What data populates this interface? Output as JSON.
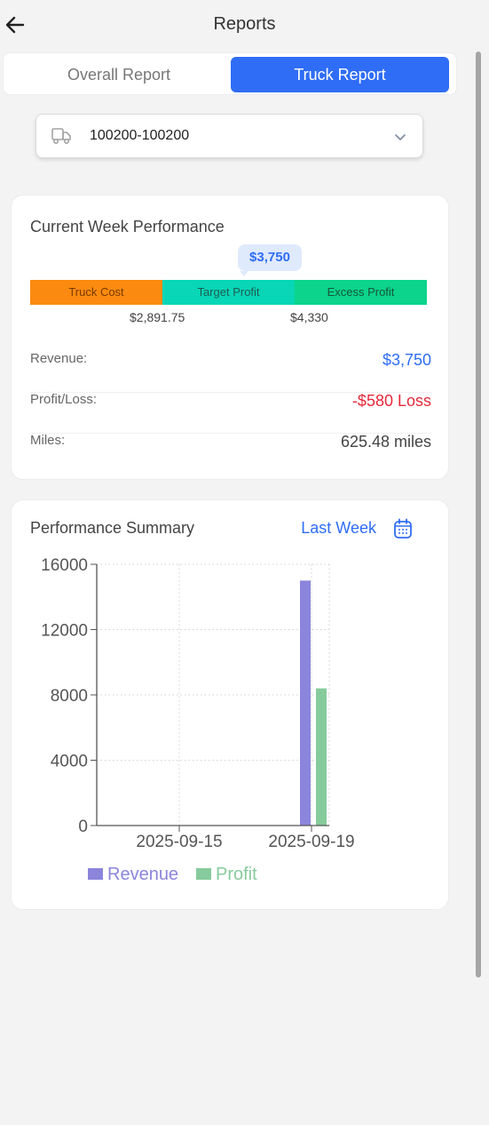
{
  "header": {
    "title": "Reports"
  },
  "tabs": [
    {
      "label": "Overall Report",
      "active": false
    },
    {
      "label": "Truck Report",
      "active": true
    }
  ],
  "truck_select": {
    "value": "100200-100200"
  },
  "current_week": {
    "title": "Current Week Performance",
    "marker_value": "$3,750",
    "segments": [
      "Truck Cost",
      "Target Profit",
      "Excess Profit"
    ],
    "thresholds": [
      "$2,891.75",
      "$4,330"
    ],
    "rows": [
      {
        "label": "Revenue:",
        "value": "$3,750",
        "color": "#2f6df6"
      },
      {
        "label": "Profit/Loss:",
        "value": "-$580 Loss",
        "color": "#e5293b"
      },
      {
        "label": "Miles:",
        "value": "625.48 miles",
        "color": "#444444"
      }
    ]
  },
  "performance_summary": {
    "title": "Performance Summary",
    "period_label": "Last Week",
    "colors": {
      "revenue": "#8b85dc",
      "profit": "#86cb9c"
    }
  },
  "chart_data": {
    "type": "bar",
    "categories": [
      "2025-09-15",
      "2025-09-19"
    ],
    "series": [
      {
        "name": "Revenue",
        "values": [
          0,
          15000
        ]
      },
      {
        "name": "Profit",
        "values": [
          0,
          8400
        ]
      }
    ],
    "yticks": [
      0,
      4000,
      8000,
      12000,
      16000
    ],
    "ylim": [
      0,
      16000
    ],
    "grid": true,
    "legend": "bottom"
  }
}
